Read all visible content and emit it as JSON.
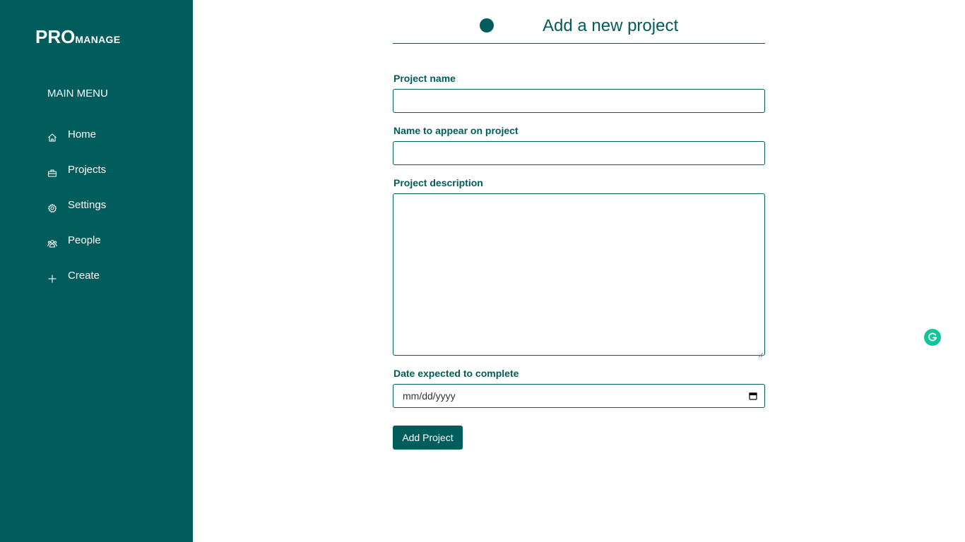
{
  "brand": {
    "logo_big": "PRO",
    "logo_small": "MANAGE"
  },
  "sidebar": {
    "heading": "MAIN MENU",
    "items": [
      {
        "label": "Home",
        "icon": "home-icon"
      },
      {
        "label": "Projects",
        "icon": "briefcase-icon"
      },
      {
        "label": "Settings",
        "icon": "gear-icon"
      },
      {
        "label": "People",
        "icon": "people-icon"
      },
      {
        "label": "Create",
        "icon": "plus-icon"
      }
    ]
  },
  "page": {
    "title": "Add a new project"
  },
  "form": {
    "project_name": {
      "label": "Project name",
      "value": "",
      "placeholder": ""
    },
    "display_name": {
      "label": "Name to appear on project",
      "value": "",
      "placeholder": ""
    },
    "description": {
      "label": "Project description",
      "value": "",
      "placeholder": ""
    },
    "due_date": {
      "label": "Date expected to complete",
      "placeholder": "mm/dd/yyyy"
    },
    "submit_label": "Add Project"
  },
  "colors": {
    "primary": "#015c5c",
    "background": "#ffffff",
    "grammarly": "#15c39a"
  }
}
